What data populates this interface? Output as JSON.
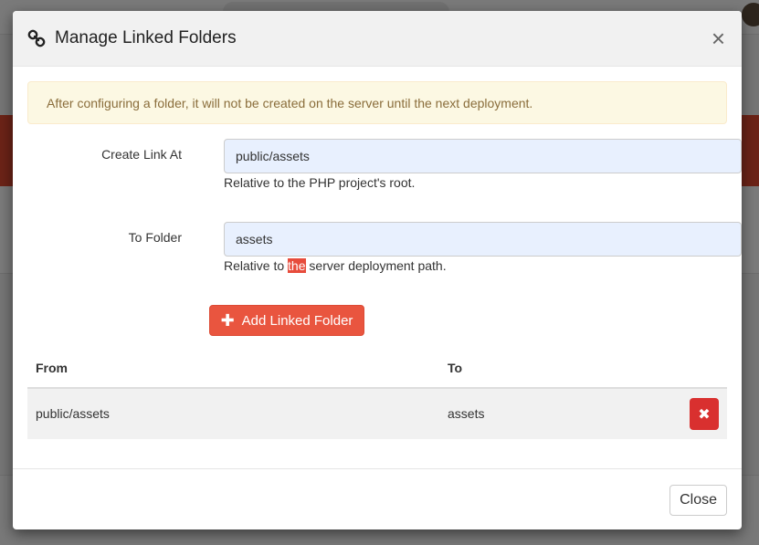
{
  "modal": {
    "title": "Manage Linked Folders",
    "close_glyph": "×",
    "alert": "After configuring a folder, it will not be created on the server until the next deployment.",
    "form": {
      "create_link_label": "Create Link At",
      "create_link_value": "public/assets",
      "create_link_help": "Relative to the PHP project's root.",
      "to_folder_label": "To Folder",
      "to_folder_value": "assets",
      "to_folder_help_before": "Relative to ",
      "to_folder_help_highlight": "the",
      "to_folder_help_after": " server deployment path.",
      "add_button_label": "Add Linked Folder"
    },
    "table": {
      "columns": [
        "From",
        "To"
      ],
      "rows": [
        {
          "from": "public/assets",
          "to": "assets"
        }
      ]
    },
    "footer": {
      "close_label": "Close"
    }
  },
  "icons": {
    "title_icon": "link-icon",
    "add_icon": "plus-icon",
    "delete_icon": "times-icon"
  },
  "colors": {
    "danger": "#e9553f",
    "delete": "#d9302f",
    "alert_bg": "#fcf8e3",
    "alert_text": "#8a6d3b",
    "input_bg": "#e8f0fe"
  }
}
